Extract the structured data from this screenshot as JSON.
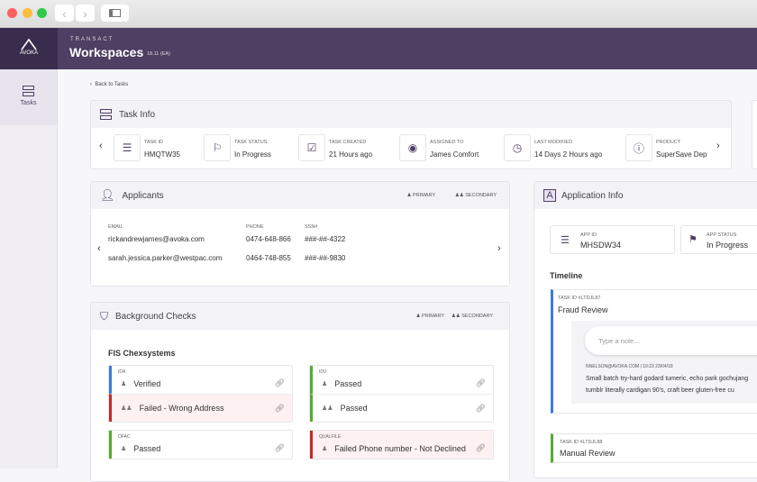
{
  "window": {
    "sidebar_toggle_icon": "sidebar-icon"
  },
  "header": {
    "logo": "AVOKA",
    "product": "TRANSACT",
    "title": "Workspaces",
    "version": "18.11 (EA)"
  },
  "sidebar": {
    "items": [
      {
        "label": "Tasks",
        "icon": "tasks-icon"
      }
    ]
  },
  "back_link": "Back to Tasks",
  "task_info": {
    "title": "Task Info",
    "fields": [
      {
        "label": "TASK ID",
        "value": "HMQTW35",
        "icon": "id-icon"
      },
      {
        "label": "TASK STATUS",
        "value": "In Progress",
        "icon": "flag-icon"
      },
      {
        "label": "TASK CREATED",
        "value": "21 Hours ago",
        "icon": "calendar-icon"
      },
      {
        "label": "ASSIGNED TO",
        "value": "James Comfort",
        "icon": "user-circle-icon"
      },
      {
        "label": "LAST MODIFIED",
        "value": "14 Days 2 Hours ago",
        "icon": "clock-icon"
      },
      {
        "label": "PRODUCT",
        "value": "SuperSave Dep",
        "icon": "info-icon"
      }
    ]
  },
  "applicants": {
    "title": "Applicants",
    "legend_primary": "PRIMARY",
    "legend_secondary": "SECONDARY",
    "columns": [
      "EMAIL",
      "PHONE",
      "SSN#"
    ],
    "rows": [
      [
        "rickandrewjames@avoka.com",
        "0474-648-866",
        "###-##-4322"
      ],
      [
        "sarah.jessica.parker@westpac.com",
        "0464-748-855",
        "###-##-9830"
      ]
    ]
  },
  "background": {
    "title": "Background Checks",
    "legend_primary": "PRIMARY",
    "legend_secondary": "SECONDARY",
    "section": "FIS Chexsystems",
    "checks": [
      {
        "label": "IDA",
        "rows": [
          {
            "text": "Verified",
            "status": "info"
          },
          {
            "text": "Failed - Wrong Address",
            "status": "fail"
          }
        ]
      },
      {
        "label": "IDV",
        "rows": [
          {
            "text": "Passed",
            "status": "pass"
          },
          {
            "text": "Passed",
            "status": "pass"
          }
        ]
      },
      {
        "label": "OFAC",
        "rows": [
          {
            "text": "Passed",
            "status": "pass"
          }
        ]
      },
      {
        "label": "QUALFILE",
        "rows": [
          {
            "text": "Failed Phone number - Not Declined",
            "status": "fail"
          }
        ]
      }
    ]
  },
  "app_info": {
    "title": "Application Info",
    "app_id_label": "APP ID",
    "app_id": "MHSDW34",
    "app_status_label": "APP STATUS",
    "app_status": "In Progress",
    "timeline_title": "Timeline",
    "timeline": [
      {
        "task_id": "TASK ID #LTDJL87",
        "title": "Fraud Review",
        "note_placeholder": "Type a note...",
        "note_meta": "NNELSON@AVOKA.COM  |  10:23 23/04/18",
        "note_text": "Small batch try-hard godard tumeric, echo park gochujang tumblr literally cardigan 90's, craft beer gluten-free cu"
      },
      {
        "task_id": "TASK ID #LTDJL88",
        "title": "Manual Review"
      }
    ]
  },
  "colors": {
    "brand": "#4f3f63",
    "info": "#3b7dd8",
    "pass": "#5aa832",
    "fail": "#c62828"
  }
}
